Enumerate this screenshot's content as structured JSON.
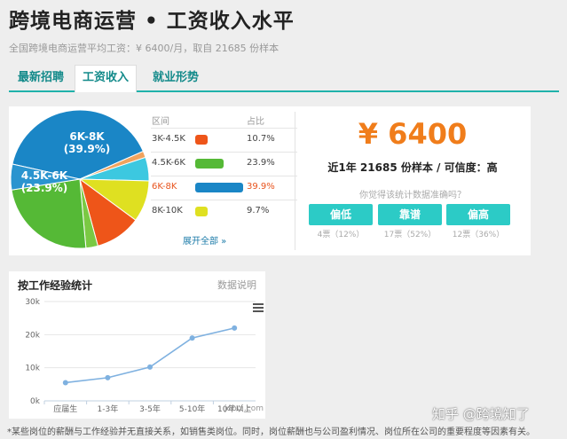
{
  "header": {
    "title": "跨境电商运营 • 工资收入水平",
    "subtitle": "全国跨境电商运营平均工资：¥ 6400/月，取自 21685 份样本"
  },
  "tabs": [
    {
      "label": "最新招聘",
      "active": false
    },
    {
      "label": "工资收入",
      "active": true
    },
    {
      "label": "就业形势",
      "active": false
    }
  ],
  "pie": {
    "legend_headers": {
      "range": "区间",
      "share": "占比"
    },
    "slices": [
      {
        "label": "6K-8K",
        "pct": "(39.9%)",
        "value": 39.9,
        "color": "#1a86c6"
      },
      {
        "label": "",
        "value": 1.5,
        "color": "#f0a35e"
      },
      {
        "label": "",
        "value": 5.5,
        "color": "#3cc8e0"
      },
      {
        "label": "8K-10K",
        "value": 9.7,
        "color": "#dfe021"
      },
      {
        "label": "3K-4.5K",
        "value": 10.7,
        "color": "#ee5519"
      },
      {
        "label": "",
        "value": 2.8,
        "color": "#7ac943"
      },
      {
        "label": "4.5K-6K",
        "pct": "(23.9%)",
        "value": 23.9,
        "color": "#55b936"
      },
      {
        "label": "",
        "value": 6.0,
        "color": "#2a94cf"
      }
    ],
    "legend": [
      {
        "range": "3K-4.5K",
        "pct": "10.7%",
        "value": 10.7,
        "color": "#ee5519",
        "active": false
      },
      {
        "range": "4.5K-6K",
        "pct": "23.9%",
        "value": 23.9,
        "color": "#55b936",
        "active": false
      },
      {
        "range": "6K-8K",
        "pct": "39.9%",
        "value": 39.9,
        "color": "#1a86c6",
        "active": true
      },
      {
        "range": "8K-10K",
        "pct": "9.7%",
        "value": 9.7,
        "color": "#dfe021",
        "active": false
      }
    ],
    "expand_label": "展开全部 »"
  },
  "summary": {
    "salary": "¥ 6400",
    "sample_line": "近1年 21685 份样本 / 可信度：高",
    "question": "你觉得该统计数据准确吗？",
    "votes": [
      {
        "label": "偏低",
        "count": "4票（12%）"
      },
      {
        "label": "靠谱",
        "count": "17票（52%）"
      },
      {
        "label": "偏高",
        "count": "12票（36%）"
      }
    ]
  },
  "experience": {
    "title": "按工作经验统计",
    "link": "数据说明",
    "credit": "jobui.com"
  },
  "chart_data": {
    "type": "line",
    "categories": [
      "应届生",
      "1-3年",
      "3-5年",
      "5-10年",
      "10年以上"
    ],
    "values": [
      5500,
      7000,
      10200,
      19000,
      22000
    ],
    "yticks": [
      "0k",
      "10k",
      "20k",
      "30k"
    ],
    "ylim": [
      0,
      30000
    ],
    "color": "#7fb1e0",
    "grid": true
  },
  "footnote": "*某些岗位的薪酬与工作经验并无直接关系，如销售类岗位。同时，岗位薪酬也与公司盈利情况、岗位所在公司的重要程度等因素有关。",
  "watermark": "知乎 @跨境知了"
}
